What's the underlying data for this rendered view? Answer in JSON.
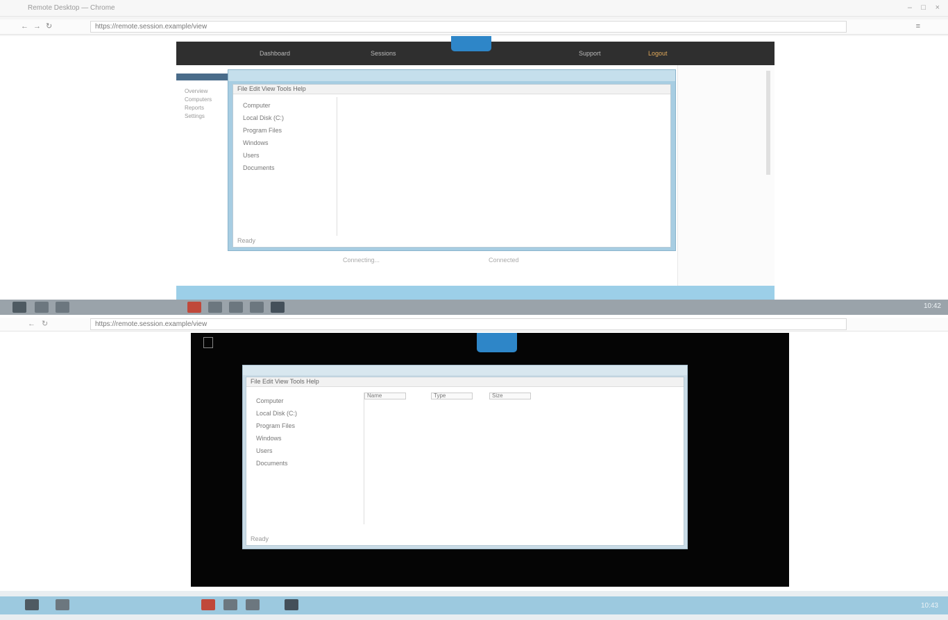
{
  "top_window": {
    "title": "Remote Desktop — Chrome",
    "address": "https://remote.session.example/view"
  },
  "remote_top": {
    "header_links": [
      "Dashboard",
      "Sessions",
      "Support",
      "Logout"
    ],
    "left_menu": [
      "Overview",
      "Computers",
      "Reports",
      "Settings"
    ],
    "dialog": {
      "toolbar": "File  Edit  View  Tools  Help",
      "tree_items": [
        "Computer",
        "Local Disk (C:)",
        "Program Files",
        "Windows",
        "Users",
        "Documents"
      ],
      "status": "Ready"
    },
    "bottom_labels": [
      "Connecting...",
      "Connected"
    ]
  },
  "taskbar_mid": {
    "clock": "10:42"
  },
  "address2": "https://remote.session.example/view",
  "remote_bottom": {
    "dialog": {
      "toolbar": "File  Edit  View  Tools  Help",
      "fields": [
        "Name",
        "Type",
        "Size"
      ],
      "tree_items": [
        "Computer",
        "Local Disk (C:)",
        "Program Files",
        "Windows",
        "Users",
        "Documents"
      ],
      "status": "Ready"
    }
  },
  "taskbar_bottom": {
    "clock": "10:43"
  },
  "colors": {
    "accent": "#2e86c8",
    "remote_bg": "#050505",
    "taskbar": "#9cc9df"
  }
}
